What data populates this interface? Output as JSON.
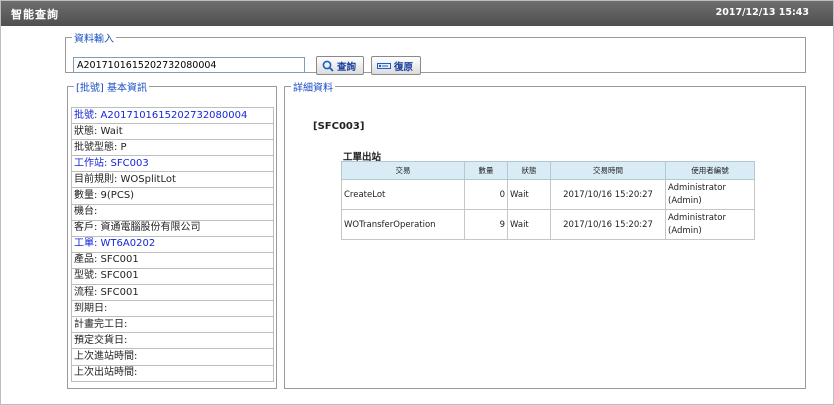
{
  "header": {
    "title": "智能查詢",
    "datetime": "2017/12/13 15:43"
  },
  "input_section": {
    "legend": "資料輸入",
    "lot_value": "A2017101615202732080004",
    "query_label": "查詢",
    "reset_label": "復原",
    "icons": [
      "search-icon",
      "reset-icon"
    ]
  },
  "basic_info": {
    "legend": "[批號] 基本資訊",
    "rows": [
      "批號: A2017101615202732080004",
      "狀態: Wait",
      "批號型態: P",
      "工作站: SFC003",
      "目前規則: WOSplitLot",
      "數量: 9(PCS)",
      "機台:",
      "客戶: 資通電腦股份有限公司",
      "工單: WT6A0202",
      "產品: SFC001",
      "型號: SFC001",
      "流程: SFC001",
      "到期日:",
      "計畫完工日:",
      "預定交貨日:",
      "上次進站時間:",
      "上次出站時間:"
    ],
    "highlight_color": "#1426d8"
  },
  "details": {
    "legend": "詳細資料",
    "station_code": "[SFC003]",
    "table_title": "工單出站",
    "columns": [
      "交易",
      "數量",
      "狀態",
      "交易時間",
      "使用者編號"
    ],
    "rows": [
      {
        "tx": "CreateLot",
        "qty": "0",
        "status": "Wait",
        "time": "2017/10/16 15:20:27",
        "user1": "Administrator",
        "user2": "(Admin)"
      },
      {
        "tx": "WOTransferOperation",
        "qty": "9",
        "status": "Wait",
        "time": "2017/10/16 15:20:27",
        "user1": "Administrator",
        "user2": "(Admin)"
      }
    ],
    "header_color": "#d9ecf6"
  }
}
